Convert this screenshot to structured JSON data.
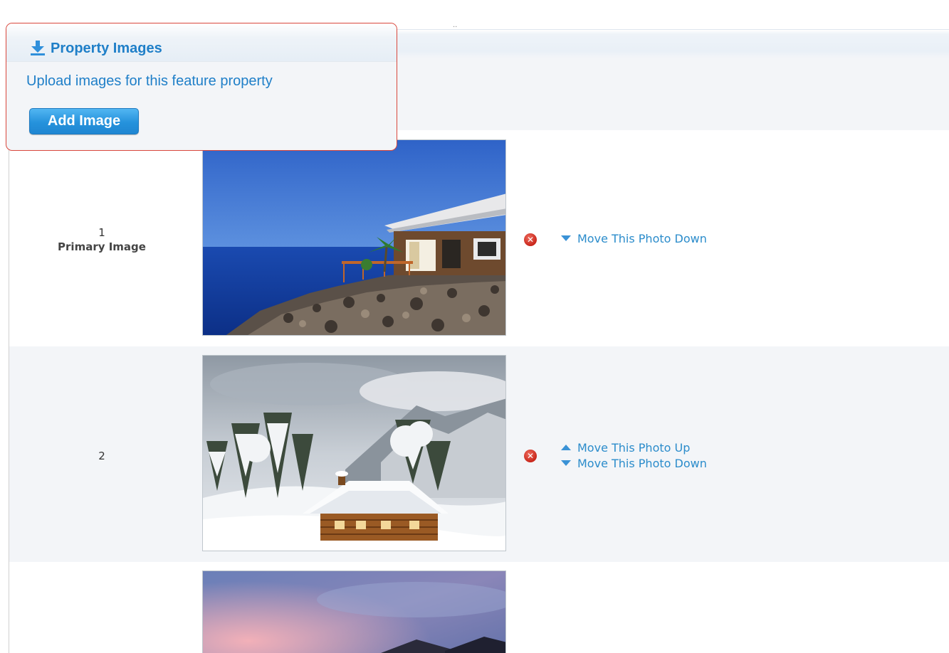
{
  "colors": {
    "accent": "#1f7fc8",
    "panel_border": "#d9473c",
    "delete": "#c8261b",
    "link": "#2b8ccb"
  },
  "panel": {
    "icon": "download-icon",
    "title": "Property Images",
    "description": "Upload images for this feature property",
    "add_button_label": "Add Image"
  },
  "photos": [
    {
      "order": "1",
      "sublabel": "Primary Image",
      "scene": "house-cliff-ocean",
      "delete_icon": "close-circle-icon",
      "actions": [
        {
          "direction": "down",
          "label": "Move This Photo Down"
        }
      ]
    },
    {
      "order": "2",
      "sublabel": "",
      "scene": "snowy-cabin",
      "delete_icon": "close-circle-icon",
      "actions": [
        {
          "direction": "up",
          "label": "Move This Photo Up"
        },
        {
          "direction": "down",
          "label": "Move This Photo Down"
        }
      ]
    },
    {
      "order": "",
      "sublabel": "",
      "scene": "house-sunset",
      "delete_icon": "close-circle-icon",
      "actions": []
    }
  ]
}
